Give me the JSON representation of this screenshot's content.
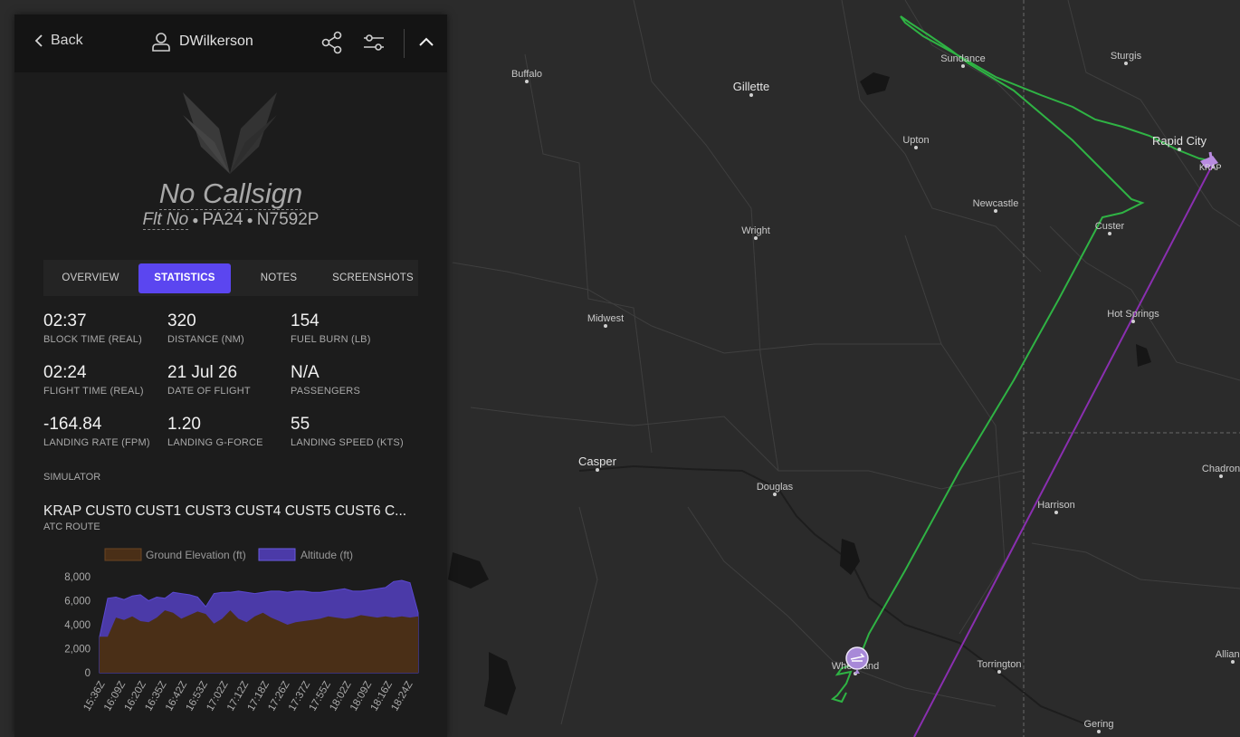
{
  "header": {
    "back_label": "Back",
    "username": "DWilkerson"
  },
  "flight": {
    "callsign": "No Callsign",
    "flt_no": "Flt No",
    "aircraft": "PA24",
    "registration": "N7592P"
  },
  "tabs": [
    {
      "label": "OVERVIEW"
    },
    {
      "label": "STATISTICS"
    },
    {
      "label": "NOTES"
    },
    {
      "label": "SCREENSHOTS"
    }
  ],
  "active_tab": "STATISTICS",
  "stats": [
    {
      "value": "02:37",
      "label": "BLOCK TIME (REAL)"
    },
    {
      "value": "320",
      "label": "DISTANCE (NM)"
    },
    {
      "value": "154",
      "label": "FUEL BURN (LB)"
    },
    {
      "value": "02:24",
      "label": "FLIGHT TIME (REAL)"
    },
    {
      "value": "21 Jul 26",
      "label": "DATE OF FLIGHT"
    },
    {
      "value": "N/A",
      "label": "PASSENGERS"
    },
    {
      "value": "-164.84",
      "label": "LANDING RATE (FPM)"
    },
    {
      "value": "1.20",
      "label": "LANDING G-FORCE"
    },
    {
      "value": "55",
      "label": "LANDING SPEED (KTS)"
    }
  ],
  "simulator_label": "SIMULATOR",
  "route": {
    "value": "KRAP CUST0 CUST1 CUST3 CUST4 CUST5 CUST6 C...",
    "label": "ATC ROUTE"
  },
  "colors": {
    "accent": "#5b46f0",
    "flight_path": "#2fb344",
    "planned_path": "#8a2fb0",
    "ground": "#4a2f17",
    "altitude": "#4b3aa8"
  },
  "map": {
    "cities": [
      {
        "name": "Buffalo"
      },
      {
        "name": "Gillette"
      },
      {
        "name": "Sundance"
      },
      {
        "name": "Sturgis"
      },
      {
        "name": "Rapid City"
      },
      {
        "name": "Upton"
      },
      {
        "name": "Newcastle"
      },
      {
        "name": "Custer"
      },
      {
        "name": "Wright"
      },
      {
        "name": "Midwest"
      },
      {
        "name": "Hot Springs"
      },
      {
        "name": "Casper"
      },
      {
        "name": "Douglas"
      },
      {
        "name": "Harrison"
      },
      {
        "name": "Chadron"
      },
      {
        "name": "Wheatland"
      },
      {
        "name": "Torrington"
      },
      {
        "name": "Gering"
      },
      {
        "name": "Alliance"
      }
    ],
    "airport_label": "KRAP"
  },
  "chart_data": {
    "type": "area",
    "series": [
      {
        "name": "Ground Elevation (ft)",
        "values": [
          3000,
          3000,
          4600,
          4400,
          4700,
          4300,
          4200,
          4600,
          5200,
          5000,
          4500,
          4800,
          5100,
          4900,
          4100,
          4500,
          5200,
          4500,
          4200,
          4700,
          5000,
          4600,
          4300,
          4000,
          4200,
          4300,
          4400,
          4500,
          4700,
          4600,
          4500,
          4600,
          4800,
          4700,
          4600,
          4700,
          4600,
          4700,
          4600,
          4700
        ]
      },
      {
        "name": "Altitude (ft)",
        "values": [
          3000,
          6200,
          6300,
          6100,
          6400,
          6500,
          6000,
          6300,
          6200,
          6700,
          6600,
          6500,
          6300,
          5500,
          6600,
          6700,
          6700,
          6800,
          6700,
          6600,
          6700,
          6800,
          6800,
          6700,
          6800,
          6800,
          6700,
          6700,
          6800,
          6900,
          7000,
          6800,
          6800,
          6900,
          7000,
          7100,
          7600,
          7700,
          7500,
          5000
        ]
      }
    ],
    "x": [
      "15:36Z",
      "16:09Z",
      "16:20Z",
      "16:35Z",
      "16:42Z",
      "16:53Z",
      "17:02Z",
      "17:12Z",
      "17:18Z",
      "17:26Z",
      "17:37Z",
      "17:55Z",
      "18:02Z",
      "18:09Z",
      "18:16Z",
      "18:24Z"
    ],
    "ylim": [
      0,
      8000
    ],
    "yticks": [
      "0",
      "2,000",
      "4,000",
      "6,000",
      "8,000"
    ],
    "legend_position": "top"
  }
}
